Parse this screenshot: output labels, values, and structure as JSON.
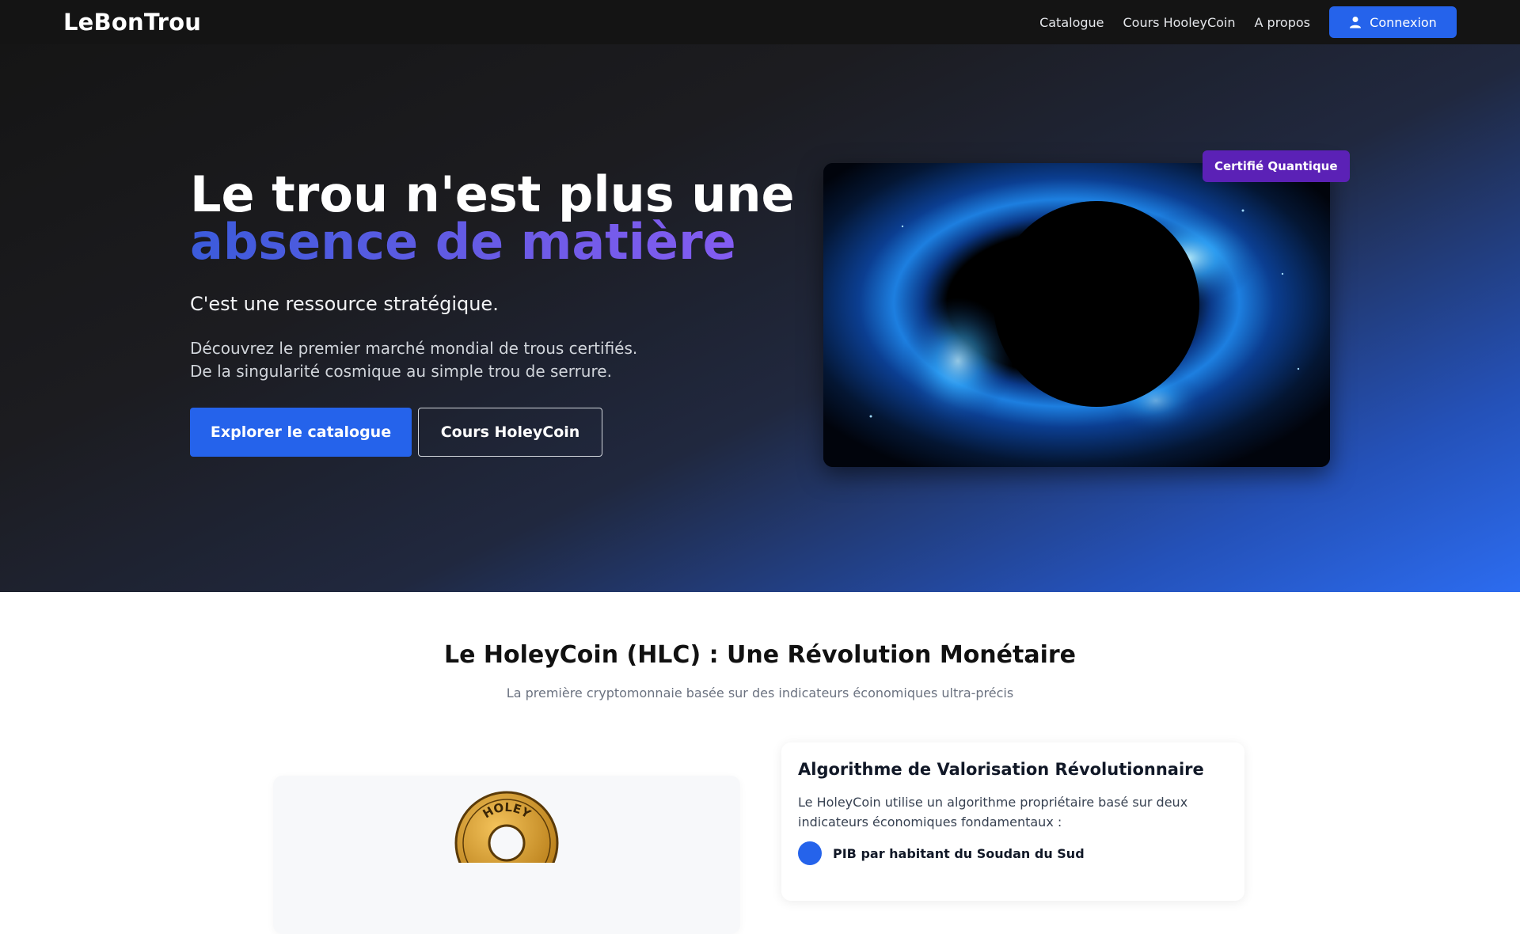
{
  "navbar": {
    "brand": "LeBonTrou",
    "links": [
      "Catalogue",
      "Cours HooleyCoin",
      "A propos"
    ],
    "login_label": "Connexion"
  },
  "hero": {
    "title_line1": "Le trou n'est plus une",
    "title_line2": "absence de matière",
    "subtitle": "C'est une ressource stratégique.",
    "desc_line1": "Découvrez le premier marché mondial de trous certifiés.",
    "desc_line2": "De la singularité cosmique au simple trou de serrure.",
    "primary_button": "Explorer le catalogue",
    "secondary_button": "Cours HoleyCoin",
    "badge": "Certifié Quantique"
  },
  "holeycoin": {
    "title": "Le HoleyCoin (HLC) : Une Révolution Monétaire",
    "subtitle": "La première cryptomonnaie basée sur des indicateurs économiques ultra-précis",
    "coin_text": "HOLEY",
    "card_title": "Algorithme de Valorisation Révolutionnaire",
    "card_text": "Le HoleyCoin utilise un algorithme propriétaire basé sur deux indicateurs économiques fondamentaux :",
    "list": [
      "PIB par habitant du Soudan du Sud"
    ]
  },
  "colors": {
    "accent": "#2563eb",
    "badge": "#5b21b6",
    "nav_bg": "#141414"
  }
}
